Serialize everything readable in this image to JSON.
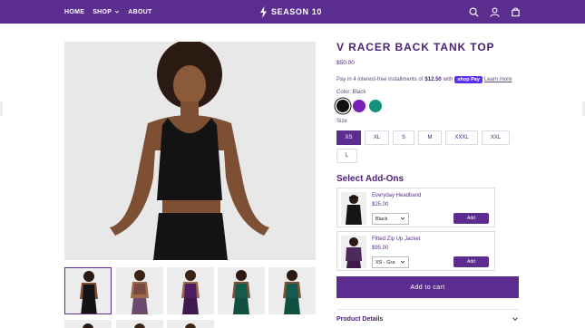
{
  "header": {
    "nav": [
      {
        "label": "HOME"
      },
      {
        "label": "SHOP"
      },
      {
        "label": "ABOUT"
      }
    ],
    "brand": "SEASON 10"
  },
  "product": {
    "title": "V RACER BACK TANK TOP",
    "price": "$50.00",
    "installment_prefix": "Pay in 4 interest-free installments of",
    "installment_amount": "$12.50",
    "installment_with": "with",
    "shoppay_label": "shop Pay",
    "learn_more": "Learn more",
    "color_label": "Color: Black",
    "colors": [
      {
        "name": "Black",
        "hex": "#111111",
        "selected": true
      },
      {
        "name": "Purple",
        "hex": "#7a1fb8",
        "selected": false
      },
      {
        "name": "Green",
        "hex": "#13917a",
        "selected": false
      }
    ],
    "size_label": "Size",
    "sizes": [
      "XS",
      "XL",
      "S",
      "M",
      "XXXL",
      "XXL",
      "L"
    ],
    "selected_size": "XS"
  },
  "addons": {
    "title": "Select Add-Ons",
    "items": [
      {
        "name": "Everyday Headband",
        "price": "$25.00",
        "option": "Black",
        "button": "Add"
      },
      {
        "name": "Fitted Zip Up Jacket",
        "price": "$95.00",
        "option": "XS - Gra",
        "button": "Add"
      }
    ]
  },
  "cart_button": "Add to cart",
  "details_label": "Product Details",
  "colors": {
    "brand": "#5b2d8e",
    "text": "#4a2374"
  }
}
